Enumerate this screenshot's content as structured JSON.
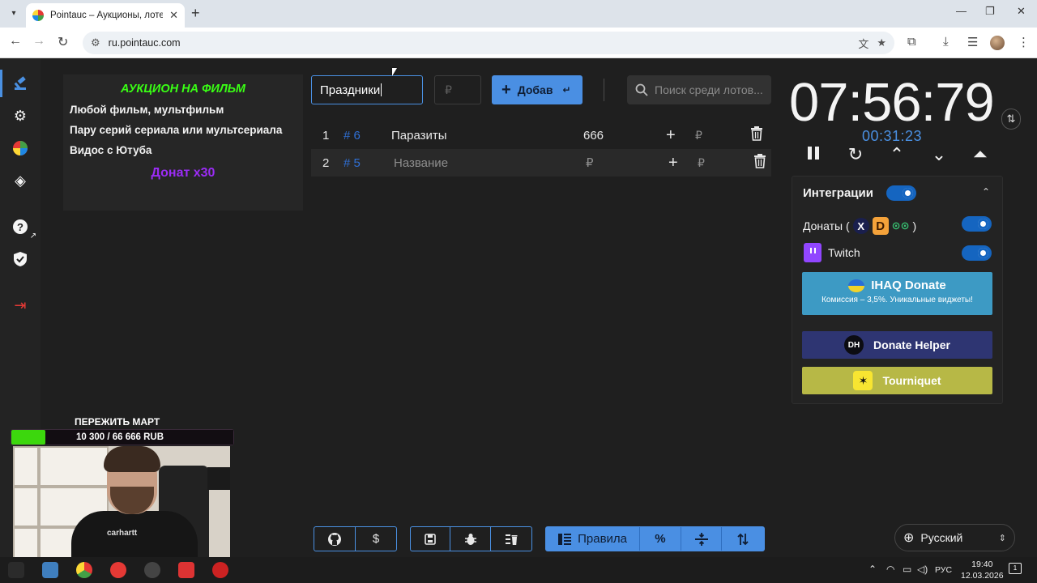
{
  "browser": {
    "tab_title": "Pointauc – Аукционы, лотереи",
    "url": "ru.pointauc.com"
  },
  "sidebar": {
    "items": [
      {
        "icon": "gavel-icon",
        "active": true
      },
      {
        "icon": "gear-icon"
      },
      {
        "icon": "wheel-icon"
      },
      {
        "icon": "layers-icon"
      },
      {
        "icon": "help-icon"
      },
      {
        "icon": "shield-icon"
      },
      {
        "icon": "logout-icon"
      }
    ]
  },
  "rules": {
    "title": "АУКЦИОН НА ФИЛЬМ",
    "lines": [
      "Любой фильм, мультфильм",
      "Пару серий сериала или мультсериала",
      "Видос с Ютуба"
    ],
    "footer": "Донат x30"
  },
  "lot_form": {
    "name_value": "Праздники",
    "price_placeholder": "₽",
    "add_label": "Добав",
    "search_placeholder": "Поиск среди лотов..."
  },
  "lots": [
    {
      "index": "1",
      "number": "# 6",
      "name": "Паразиты",
      "amount": "666",
      "currency": "₽"
    },
    {
      "index": "2",
      "number": "# 5",
      "name": "Название",
      "amount": "₽",
      "currency": "₽"
    }
  ],
  "timer": {
    "main": "07:56:79",
    "sub": "00:31:23"
  },
  "integrations": {
    "title": "Интеграции",
    "donations_label": "Донаты (",
    "donations_close": ")",
    "twitch_label": "Twitch",
    "ihaq_title": "IHAQ Donate",
    "ihaq_sub": "Комиссия – 3,5%. Уникальные виджеты!",
    "donate_helper": "Donate Helper",
    "tourniquet": "Tourniquet",
    "dh_logo": "DH"
  },
  "stream_goal": {
    "title": "ПЕРЕЖИТЬ МАРТ",
    "progress_text": "10 300 / 66 666 RUB",
    "progress_fraction": 0.1545,
    "shirt_text": "carhartt"
  },
  "toolbar": {
    "rules_label": "Правила",
    "percent_label": "%"
  },
  "language": {
    "selected": "Русский"
  },
  "taskbar": {
    "lang": "РУС",
    "time": "19:40",
    "date": "12.03.2026",
    "notifications": "1"
  },
  "colors": {
    "accent": "#4a8fe3",
    "rules_title": "#39ff14",
    "rules_footer": "#9b2cf5",
    "twitch": "#9146ff",
    "ihaq": "#3d9ac4",
    "donate_helper": "#2e3572",
    "tourniquet": "#b7b846"
  }
}
